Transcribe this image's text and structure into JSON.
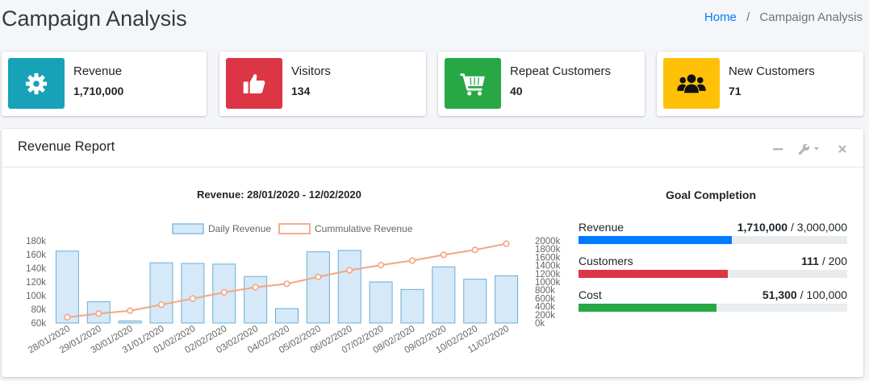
{
  "page": {
    "title": "Campaign Analysis"
  },
  "breadcrumb": {
    "home": "Home",
    "separator": "/",
    "current": "Campaign Analysis"
  },
  "info_boxes": [
    {
      "label": "Revenue",
      "value": "1,710,000",
      "icon": "gear-icon",
      "color": "#17a2b8"
    },
    {
      "label": "Visitors",
      "value": "134",
      "icon": "thumbs-up-icon",
      "color": "#dc3545"
    },
    {
      "label": "Repeat Customers",
      "value": "40",
      "icon": "shopping-cart-icon",
      "color": "#28a745"
    },
    {
      "label": "New Customers",
      "value": "71",
      "icon": "users-icon",
      "color": "#ffc107"
    }
  ],
  "card": {
    "title": "Revenue Report",
    "tools": [
      "minimize-icon",
      "wrench-icon",
      "close-icon"
    ]
  },
  "chart_data": {
    "type": "bar",
    "title": "Revenue: 28/01/2020 - 12/02/2020",
    "categories": [
      "28/01/2020",
      "29/01/2020",
      "30/01/2020",
      "31/01/2020",
      "01/02/2020",
      "02/02/2020",
      "03/02/2020",
      "04/02/2020",
      "05/02/2020",
      "06/02/2020",
      "07/02/2020",
      "08/02/2020",
      "09/02/2020",
      "10/02/2020",
      "11/02/2020"
    ],
    "series": [
      {
        "name": "Daily Revenue",
        "type": "bar",
        "axis": "left",
        "color": "#9ecae1",
        "values": [
          165000,
          91000,
          63000,
          148000,
          147000,
          146000,
          128000,
          81000,
          164000,
          166000,
          120000,
          109000,
          142000,
          124000,
          129000
        ]
      },
      {
        "name": "Cummulative Revenue",
        "type": "line",
        "axis": "right",
        "color": "#f4a582",
        "values": [
          140000,
          230000,
          300000,
          445000,
          595000,
          745000,
          870000,
          955000,
          1120000,
          1285000,
          1410000,
          1520000,
          1660000,
          1780000,
          1930000
        ]
      }
    ],
    "y_left": {
      "ticks": [
        "60k",
        "80k",
        "100k",
        "120k",
        "140k",
        "160k",
        "180k"
      ],
      "min": 60000,
      "max": 180000
    },
    "y_right": {
      "ticks": [
        "0k",
        "200k",
        "400k",
        "600k",
        "800k",
        "1000k",
        "1200k",
        "1400k",
        "1600k",
        "1800k",
        "2000k"
      ],
      "min": 0,
      "max": 2000000
    },
    "legend": "top",
    "grid": false
  },
  "goals": {
    "title": "Goal Completion",
    "items": [
      {
        "label": "Revenue",
        "current": "1,710,000",
        "target": "/ 3,000,000",
        "fraction": 0.57,
        "color": "#007bff"
      },
      {
        "label": "Customers",
        "current": "111",
        "target": "/ 200",
        "fraction": 0.555,
        "color": "#dc3545"
      },
      {
        "label": "Cost",
        "current": "51,300",
        "target": "/ 100,000",
        "fraction": 0.513,
        "color": "#28a745"
      }
    ]
  }
}
